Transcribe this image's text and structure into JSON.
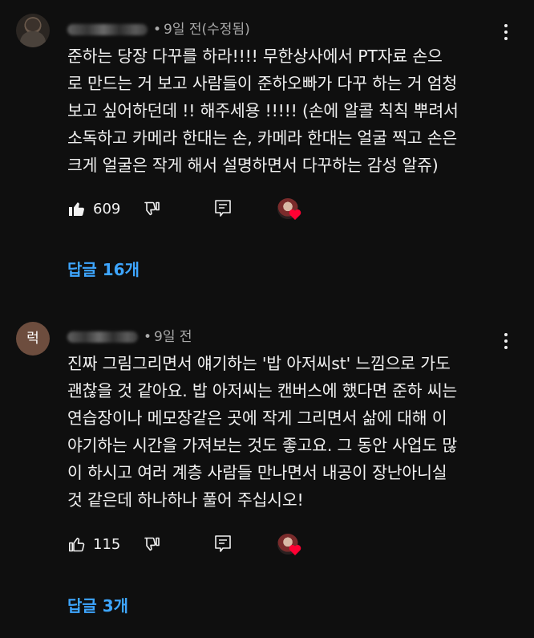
{
  "comments": [
    {
      "avatar_type": "photo",
      "timestamp": "9일 전(수정됨)",
      "text": "준하는 당장 다꾸를 하라!!!!  무한상사에서 PT자료 손으\n로 만드는 거 보고 사람들이 준하오빠가 다꾸 하는 거 엄청\n보고 싶어하던데 !! 해주세용 !!!!! (손에 알콜 칙칙 뿌려서\n소독하고 카메라 한대는 손, 카메라 한대는 얼굴 찍고 손은\n크게 얼굴은 작게 해서 설명하면서 다꾸하는 감성 알쥬)",
      "like_count": "609",
      "like_filled": true,
      "creator_heart": true,
      "replies_label": "답글 16개"
    },
    {
      "avatar_type": "letter",
      "avatar_letter": "럭",
      "timestamp": "9일 전",
      "text": "진짜 그림그리면서 얘기하는 '밥 아저씨st' 느낌으로 가도\n괜찮을 것 같아요. 밥 아저씨는 캔버스에 했다면 준하 씨는\n연습장이나 메모장같은 곳에 작게 그리면서 삶에 대해 이\n야기하는 시간을 가져보는 것도 좋고요. 그 동안 사업도 많\n이 하시고 여러 계층 사람들 만나면서 내공이 장난아니실\n것 같은데 하나하나 풀어 주십시오!",
      "like_count": "115",
      "like_filled": false,
      "creator_heart": true,
      "replies_label": "답글 3개"
    }
  ],
  "colors": {
    "background": "#0f0f0f",
    "text": "#f1f1f1",
    "meta": "#aaaaaa",
    "link": "#3ea6ff",
    "heart": "#ff0033"
  },
  "icons": [
    "thumbs-up-icon",
    "thumbs-down-icon",
    "reply-icon",
    "more-vert-icon",
    "creator-heart-icon"
  ]
}
